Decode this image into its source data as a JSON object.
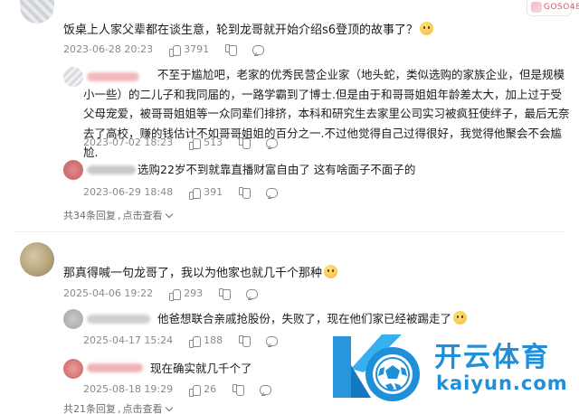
{
  "corner": {
    "count": "GOSO48"
  },
  "thread1": {
    "comment": "饭桌上人家父辈都在谈生意，轮到龙哥就开始介绍s6登顶的故事了？",
    "date": "2023-06-28 20:23",
    "likes": "3791",
    "replies": [
      {
        "text": "不至于尴尬吧，老家的优秀民营企业家（地头蛇，类似选购的家族企业，但是规模小一些）的二儿子和我同届的，一路学霸到了博士.但是由于和哥哥姐姐年龄差太大，加上过于受父母宠爱，被哥哥姐姐等一众同辈们排挤，本科和研究生去家里公司实习被疯狂使绊子，最后无奈去了高校，赚的钱估计不如哥哥姐姐的百分之一.不过他觉得自己过得很好，我觉得他聚会不会尴尬.",
        "date": "2023-07-02 18:23",
        "likes": "513"
      },
      {
        "text": "选购22岁不到就靠直播财富自由了 这有啥面子不面子的",
        "date": "2023-06-29 18:48",
        "likes": "391"
      }
    ],
    "more": {
      "count_text": "共34条回复",
      "expand_label": "点击查看"
    }
  },
  "thread2": {
    "comment": "那真得喊一句龙哥了，我以为他家也就几千个那种",
    "date": "2025-04-06 19:22",
    "likes": "293",
    "replies": [
      {
        "text": "他爸想联合亲戚抢股份，失败了，现在他们家已经被踢走了",
        "date": "2025-04-17 15:24",
        "likes": "188"
      },
      {
        "text": "现在确实就几千个了",
        "date": "2025-08-18 19:29",
        "likes": "26"
      }
    ],
    "more": {
      "count_text": "共21条回复",
      "expand_label": "点击查看"
    }
  },
  "watermark": {
    "cn": "开云体育",
    "en": "kaiyun.com"
  },
  "colors": {
    "meta_gray": "#8a8a8a",
    "watermark_blue": "#1e8fd8",
    "emoji_yellow": "#f6b93b"
  },
  "icons": [
    "thumb-up-icon",
    "thumb-down-icon",
    "reply-bubble-icon",
    "smile-emoji-icon",
    "chevron-down-icon",
    "soccer-ball-logo"
  ]
}
